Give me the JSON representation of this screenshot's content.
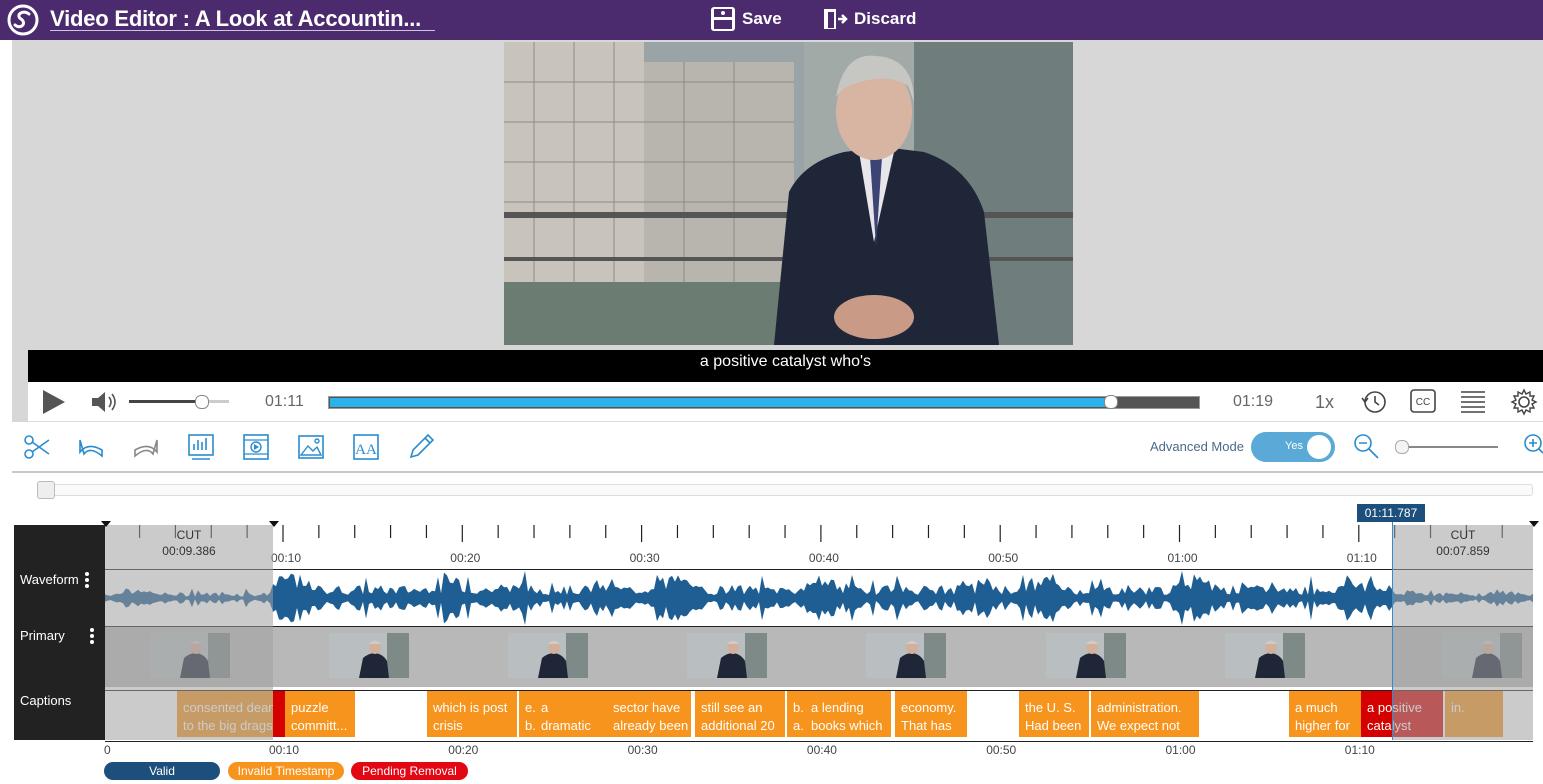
{
  "header": {
    "title": "Video Editor : A Look at Accountin...",
    "save_label": "Save",
    "discard_label": "Discard"
  },
  "player": {
    "caption_text": "a positive catalyst who's",
    "current_time": "01:11",
    "duration": "01:19",
    "speed": "1x",
    "progress_fraction": 0.9,
    "volume_fraction": 0.72,
    "icons": [
      "play-icon",
      "volume-icon",
      "history-icon",
      "cc-icon",
      "transcript-list-icon",
      "settings-gear-icon"
    ]
  },
  "toolbar": {
    "tools": [
      "scissors-icon",
      "undo-icon",
      "redo-icon",
      "chapter-slides-icon",
      "video-quiz-icon",
      "image-icon",
      "font-icon",
      "pencil-icon"
    ],
    "advanced_mode_label": "Advanced Mode",
    "advanced_mode_value": "Yes"
  },
  "timeline": {
    "rows": {
      "waveform": "Waveform",
      "primary": "Primary",
      "captions": "Captions"
    },
    "cut_start": {
      "label": "CUT",
      "time": "00:09.386"
    },
    "cut_end": {
      "label": "CUT",
      "time": "00:07.859"
    },
    "playhead": "01:11.787",
    "ruler_ticks": [
      "00:10",
      "00:20",
      "00:30",
      "00:40",
      "00:50",
      "01:00",
      "01:10"
    ],
    "bottom_ticks": [
      "0",
      "00:10",
      "00:20",
      "00:30",
      "00:40",
      "00:50",
      "01:00",
      "01:10"
    ],
    "captions": [
      {
        "l1": "consented dean",
        "l2": "to the big drags",
        "type": "orange"
      },
      {
        "l1": "",
        "l2": "",
        "type": "red"
      },
      {
        "l1": "puzzle",
        "l2": "committ...",
        "type": "orange"
      },
      {
        "l1": "which is post",
        "l2": "crisis",
        "type": "orange"
      },
      {
        "l1": "e...",
        "l2": "b...",
        "type": "orange"
      },
      {
        "l1": "a",
        "l2": "dramatic",
        "type": "orange"
      },
      {
        "l1": "sector have",
        "l2": "already been",
        "type": "orange"
      },
      {
        "l1": "still see an",
        "l2": "additional 20",
        "type": "orange"
      },
      {
        "l1": "b...",
        "l2": "a...",
        "type": "orange"
      },
      {
        "l1": "a lending",
        "l2": "books which",
        "type": "orange"
      },
      {
        "l1": "economy.",
        "l2": "That has",
        "type": "orange"
      },
      {
        "l1": "the U. S.",
        "l2": "Had been",
        "type": "orange"
      },
      {
        "l1": "administration.",
        "l2": "We expect not",
        "type": "orange"
      },
      {
        "l1": "a much",
        "l2": "higher for",
        "type": "orange"
      },
      {
        "l1": "a positive",
        "l2": "catalyst",
        "type": "red"
      },
      {
        "l1": "in.",
        "l2": "",
        "type": "orange"
      }
    ]
  },
  "legend": {
    "valid": "Valid",
    "invalid": "Invalid Timestamp",
    "pending": "Pending Removal"
  },
  "colors": {
    "header_bg": "#4b2a6e",
    "accent_blue": "#2c8fd6",
    "orange": "#f7941d",
    "red": "#d50000",
    "valid_blue": "#1c4f7c"
  }
}
